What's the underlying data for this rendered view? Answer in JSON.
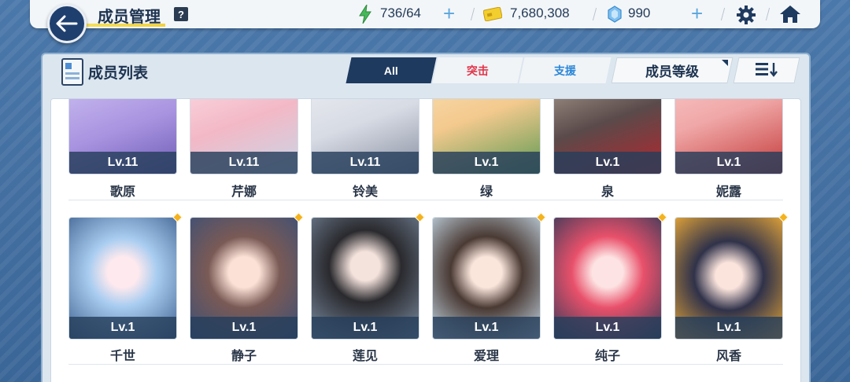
{
  "header": {
    "title": "成员管理",
    "help_label": "?",
    "stamina": "736/64",
    "credits": "7,680,308",
    "gems": "990"
  },
  "panel": {
    "title": "成员列表",
    "tabs": [
      {
        "label": "All",
        "active": true
      },
      {
        "label": "突击",
        "active": false
      },
      {
        "label": "支援",
        "active": false
      }
    ],
    "sort_label": "成员等级"
  },
  "members_row1": [
    {
      "level": "Lv.11",
      "name": "歌原",
      "color": "#b7a6e8"
    },
    {
      "level": "Lv.11",
      "name": "芹娜",
      "color": "#f3b8c6"
    },
    {
      "level": "Lv.11",
      "name": "铃美",
      "color": "#d7dbe4"
    },
    {
      "level": "Lv.1",
      "name": "绿",
      "color": "#f3c98e"
    },
    {
      "level": "Lv.1",
      "name": "泉",
      "color": "#5a4a4a"
    },
    {
      "level": "Lv.1",
      "name": "妮露",
      "color": "#f0a7a7"
    }
  ],
  "members_row2": [
    {
      "level": "Lv.1",
      "name": "千世",
      "color": "#a9cdf0"
    },
    {
      "level": "Lv.1",
      "name": "静子",
      "color": "#7a5a55"
    },
    {
      "level": "Lv.1",
      "name": "莲见",
      "color": "#2a2a2e"
    },
    {
      "level": "Lv.1",
      "name": "爱理",
      "color": "#c8dcea"
    },
    {
      "level": "Lv.1",
      "name": "纯子",
      "color": "#e8506a"
    },
    {
      "level": "Lv.1",
      "name": "风香",
      "color": "#30324a"
    }
  ],
  "colors": {
    "accent_dark": "#1f3a5f",
    "strike": "#e0354a",
    "support": "#2a86d8",
    "gem_marker": "#f4b21c"
  }
}
